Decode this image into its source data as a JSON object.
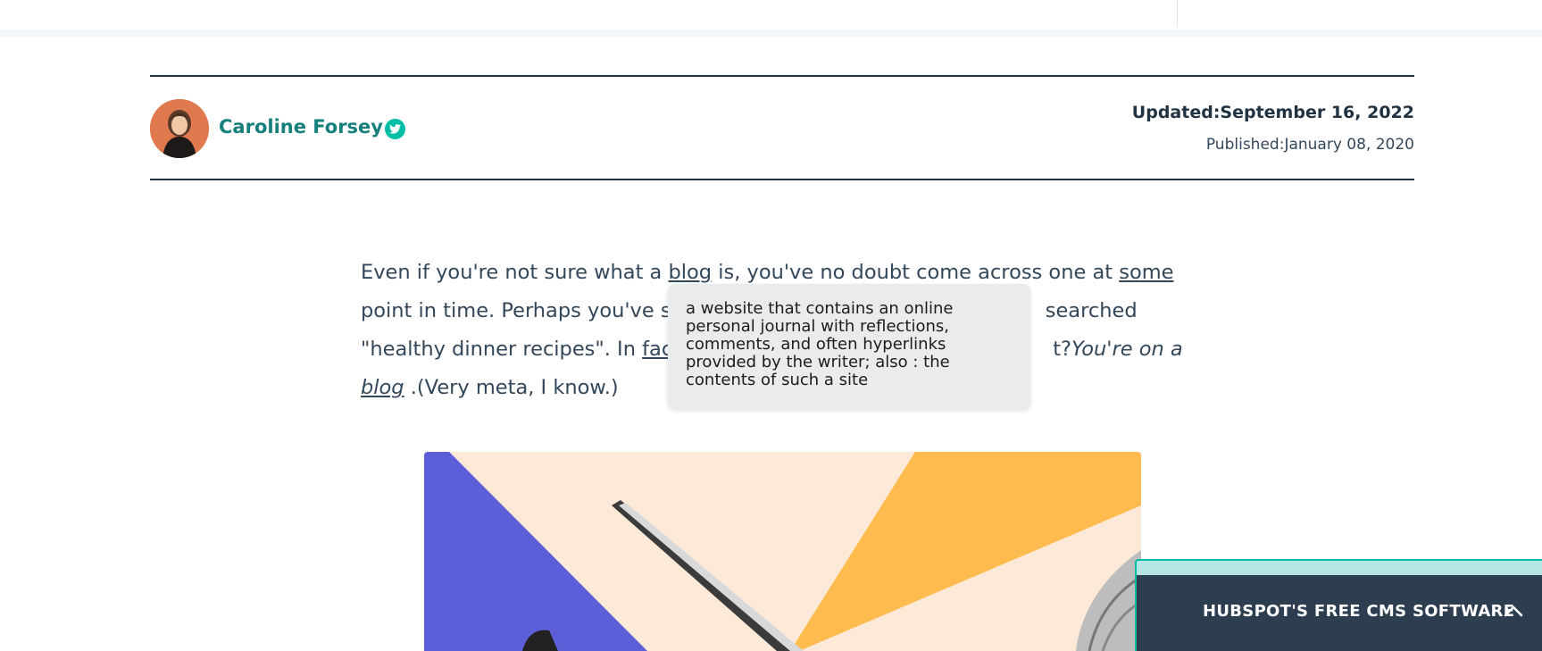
{
  "author": {
    "name": "Caroline Forsey",
    "social_icon": "twitter-icon"
  },
  "dates": {
    "updated_label": "Updated:",
    "updated_value": "September 16, 2022",
    "published_label": "Published:",
    "published_value": "January 08, 2020"
  },
  "article": {
    "line1_a": "Even if you're not sure what a ",
    "line1_link_blog": "blog",
    "line1_b": " is, you've no doubt come across one at ",
    "line1_link_some": "some",
    "line2_a": "point in time. Perhaps you've s",
    "line2_b": " searched",
    "line3_a": "\"healthy dinner recipes\". In ",
    "line3_link": "fac",
    "line3_b": "t?",
    "line3_italic": "You're on a",
    "line4_link_italic": "blog",
    "line4_b": " .(Very meta, I know.)"
  },
  "tooltip": {
    "line1": "a website that contains an online",
    "line2": "personal journal with reflections,",
    "line3": "comments, and often hyperlinks",
    "line4": "provided by the writer; also : the",
    "line5": "contents of such a site"
  },
  "cta": {
    "label": "HUBSPOT'S FREE CMS SOFTWARE",
    "icon": "chevron-up-icon"
  },
  "colors": {
    "accent_teal": "#177f7c",
    "twitter_teal": "#00bda5",
    "rule_navy": "#213343",
    "cta_bg": "#2d3e50",
    "hero_purple": "#5c5fd8",
    "hero_peach": "#fce9d7",
    "hero_orange": "#ffbb4d"
  }
}
